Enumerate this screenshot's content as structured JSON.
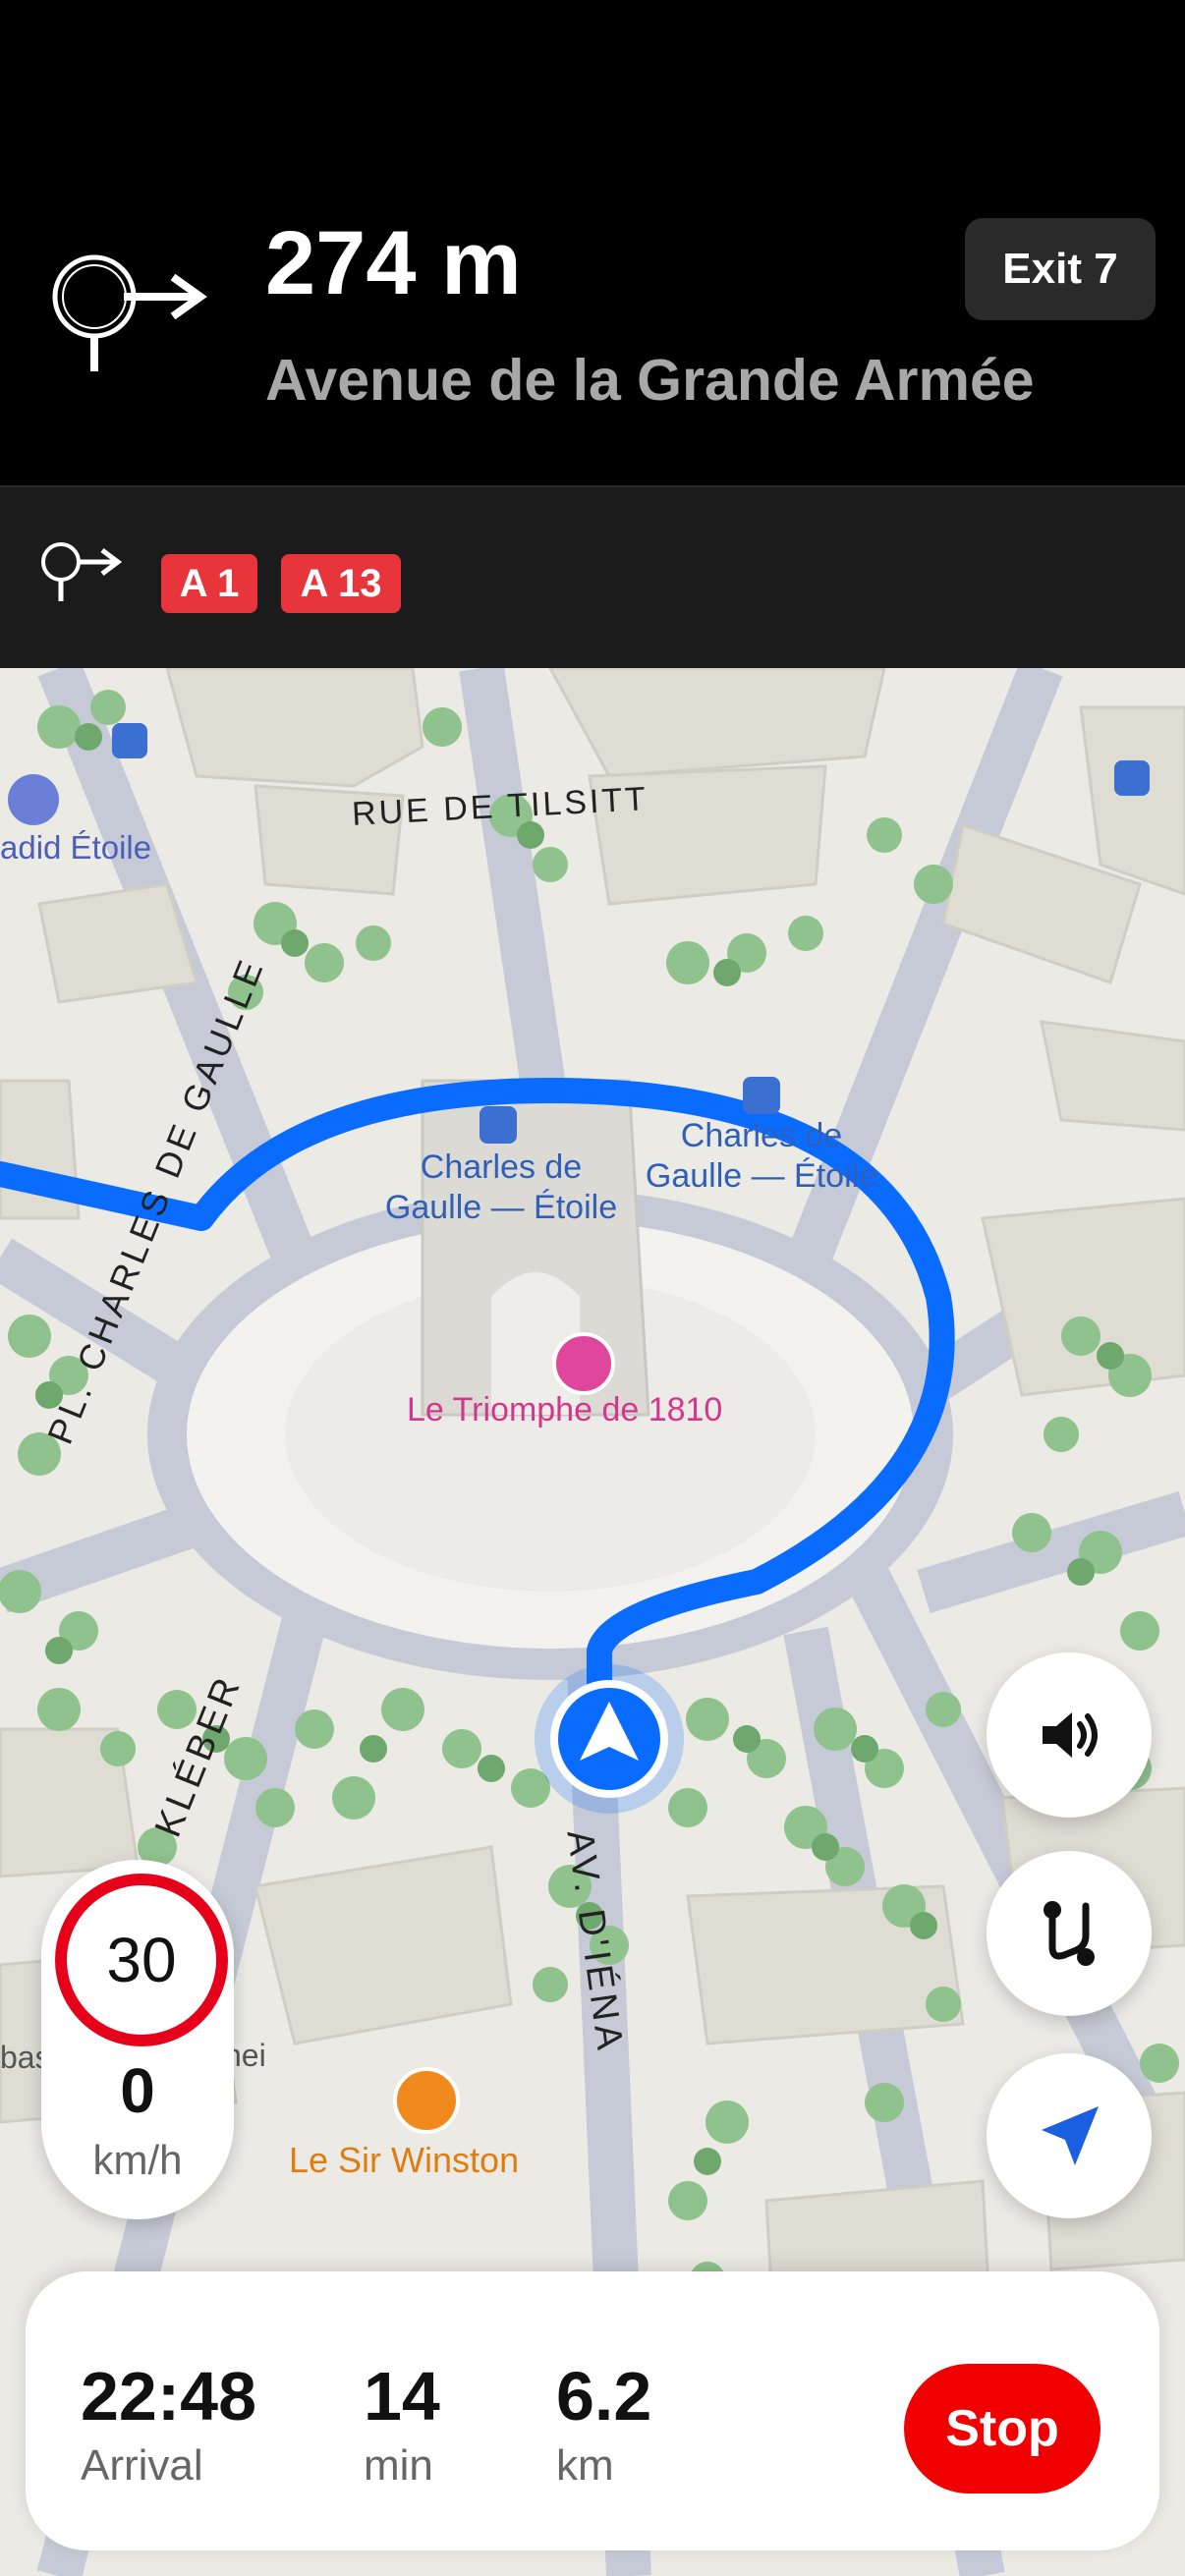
{
  "maneuver": {
    "distance": "274 m",
    "street": "Avenue de la Grande Armée",
    "exit": "Exit 7",
    "icon": "roundabout-exit-right-icon"
  },
  "next": {
    "icon": "roundabout-exit-right-icon",
    "roads": [
      "A 1",
      "A 13"
    ]
  },
  "map": {
    "labels": {
      "rue_tilsitt": "RUE DE TILSITT",
      "hotel": "adid Étoile",
      "station1": "Charles de\nGaulle — Étoile",
      "station2": "Charles de\nGaulle — Étoile",
      "monument": "Le Triomphe de 1810",
      "pl_charles": "PL. CHARLES DE GAULLE",
      "kleber": "KLÉBER",
      "iena": "AV. D'IÉNA",
      "restaurant": "Le Sir Winston",
      "partial_left": "bas",
      "partial_mid": "nei"
    },
    "colors": {
      "route": "#0a6cff",
      "poi_station": "#3b6fd0",
      "poi_monument": "#e0469b",
      "poi_restaurant": "#f08a1c"
    }
  },
  "controls": {
    "sound": "speaker-icon",
    "route": "route-overview-icon",
    "recenter": "navigation-arrow-icon"
  },
  "speed": {
    "limit": "30",
    "current": "0",
    "unit": "km/h"
  },
  "trip": {
    "arrival": {
      "value": "22:48",
      "label": "Arrival"
    },
    "duration": {
      "value": "14",
      "label": "min"
    },
    "distance": {
      "value": "6.2",
      "label": "km"
    },
    "stop": "Stop"
  }
}
